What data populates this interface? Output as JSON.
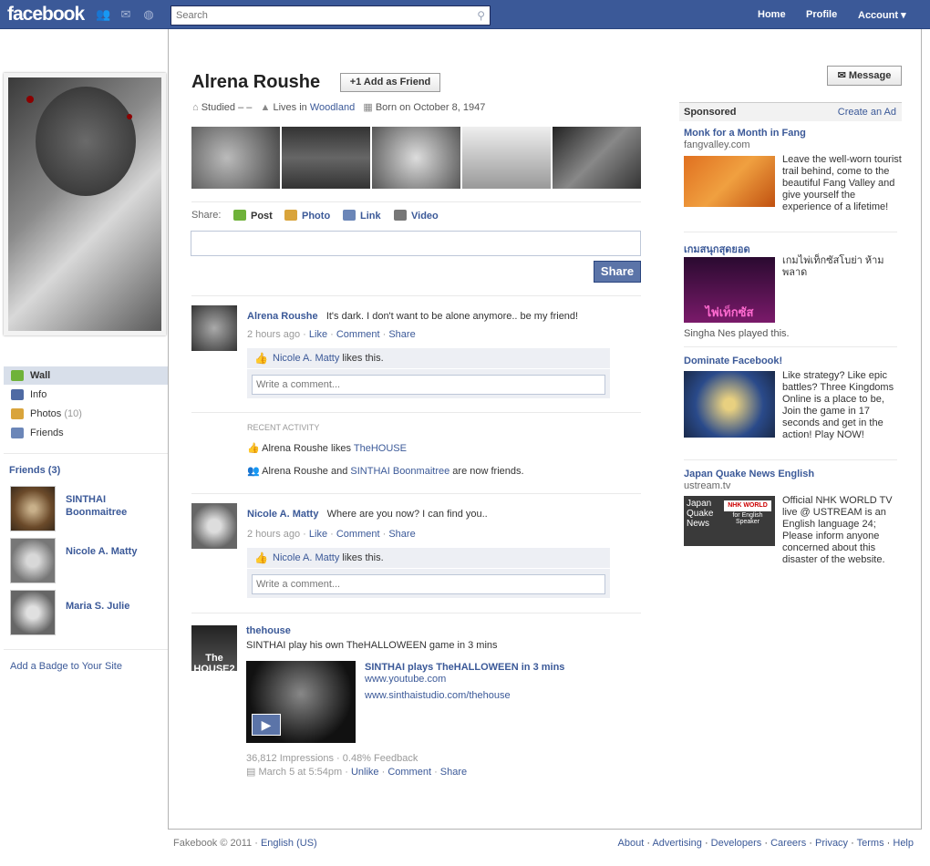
{
  "topbar": {
    "logo": "facebook",
    "search_placeholder": "Search",
    "links": [
      "Home",
      "Profile",
      "Account"
    ],
    "account_caret": "▾"
  },
  "left": {
    "nav": [
      {
        "label": "Wall",
        "icon": "wall-icon",
        "color": "#6fb23a"
      },
      {
        "label": "Info",
        "icon": "info-icon",
        "color": "#4f6aa3"
      },
      {
        "label": "Photos",
        "count": "(10)",
        "icon": "photos-icon",
        "color": "#d9a43b"
      },
      {
        "label": "Friends",
        "icon": "friends-icon",
        "color": "#6b86b8"
      }
    ],
    "friends_header": "Friends",
    "friends_count": "(3)",
    "friends": [
      {
        "name": "SINTHAI Boonmaitree"
      },
      {
        "name": "Nicole A. Matty"
      },
      {
        "name": "Maria S. Julie"
      }
    ],
    "badge_link": "Add a Badge to Your Site"
  },
  "profile": {
    "name": "Alrena Roushe",
    "add_friend": "Add as Friend",
    "message": "Message",
    "studied": "Studied – –",
    "lives_prefix": "Lives in",
    "lives_city": "Woodland",
    "born": "Born on October 8, 1947"
  },
  "share": {
    "label": "Share:",
    "items": [
      "Post",
      "Photo",
      "Link",
      "Video"
    ],
    "button": "Share"
  },
  "posts": [
    {
      "author": "Alrena Roushe",
      "text": "It's dark. I don't want to be alone anymore.. be my friend!",
      "time": "2 hours ago",
      "actions": [
        "Like",
        "Comment",
        "Share"
      ],
      "liker": "Nicole A. Matty",
      "likes_suffix": "likes this.",
      "comment_placeholder": "Write a comment..."
    },
    {
      "author": "Nicole A. Matty",
      "text": "Where are you now? I can find you..",
      "time": "2 hours ago",
      "actions": [
        "Like",
        "Comment",
        "Share"
      ],
      "liker": "Nicole A. Matty",
      "likes_suffix": "likes this.",
      "comment_placeholder": "Write a comment..."
    }
  ],
  "recent": {
    "header": "RECENT ACTIVITY",
    "line1_prefix": "Alrena Roushe likes",
    "line1_link": "TheHOUSE",
    "line2_prefix": "Alrena Roushe and",
    "line2_link": "SINTHAI Boonmaitree",
    "line2_suffix": "are now friends."
  },
  "thehouse": {
    "author": "thehouse",
    "text": "SINTHAI play his own TheHALLOWEEN game in 3 mins",
    "video_title": "SINTHAI plays TheHALLOWEEN in 3 mins",
    "video_url1": "www.youtube.com",
    "video_url2": "www.sinthaistudio.com/thehouse",
    "impressions": "36,812 Impressions · 0.48% Feedback",
    "time": "March 5 at 5:54pm",
    "actions": [
      "Unlike",
      "Comment",
      "Share"
    ],
    "thumb_text": "The HOUSE2"
  },
  "sidebar": {
    "sponsored": "Sponsored",
    "create_ad": "Create an Ad",
    "ads": [
      {
        "title": "Monk for a Month in Fang",
        "domain": "fangvalley.com",
        "desc": "Leave the well-worn tourist trail behind, come to the beautiful Fang Valley and give yourself the experience of a lifetime!"
      },
      {
        "title": "เกมสนุกสุดยอด",
        "domain": "",
        "desc": "เกมไพ่เท็กซัสโบย่า ห้ามพลาด",
        "social": "Singha Nes played this.",
        "img_text": "ไพ่เท็กซัส"
      },
      {
        "title": "Dominate Facebook!",
        "domain": "",
        "desc": "Like strategy? Like epic battles? Three Kingdoms Online is a place to be, Join the game in 17 seconds and get in the action! Play NOW!"
      },
      {
        "title": "Japan Quake News English",
        "domain": "ustream.tv",
        "desc": "Official NHK WORLD TV live @ USTREAM is an English language 24; Please inform anyone concerned about this disaster of the website.",
        "img_text": "Japan Quake News",
        "img_badge": "NHK WORLD",
        "img_sub": "for English Speaker"
      }
    ]
  },
  "footer": {
    "copyright": "Fakebook © 2011 ·",
    "language": "English (US)",
    "links": [
      "About",
      "Advertising",
      "Developers",
      "Careers",
      "Privacy",
      "Terms",
      "Help"
    ]
  }
}
